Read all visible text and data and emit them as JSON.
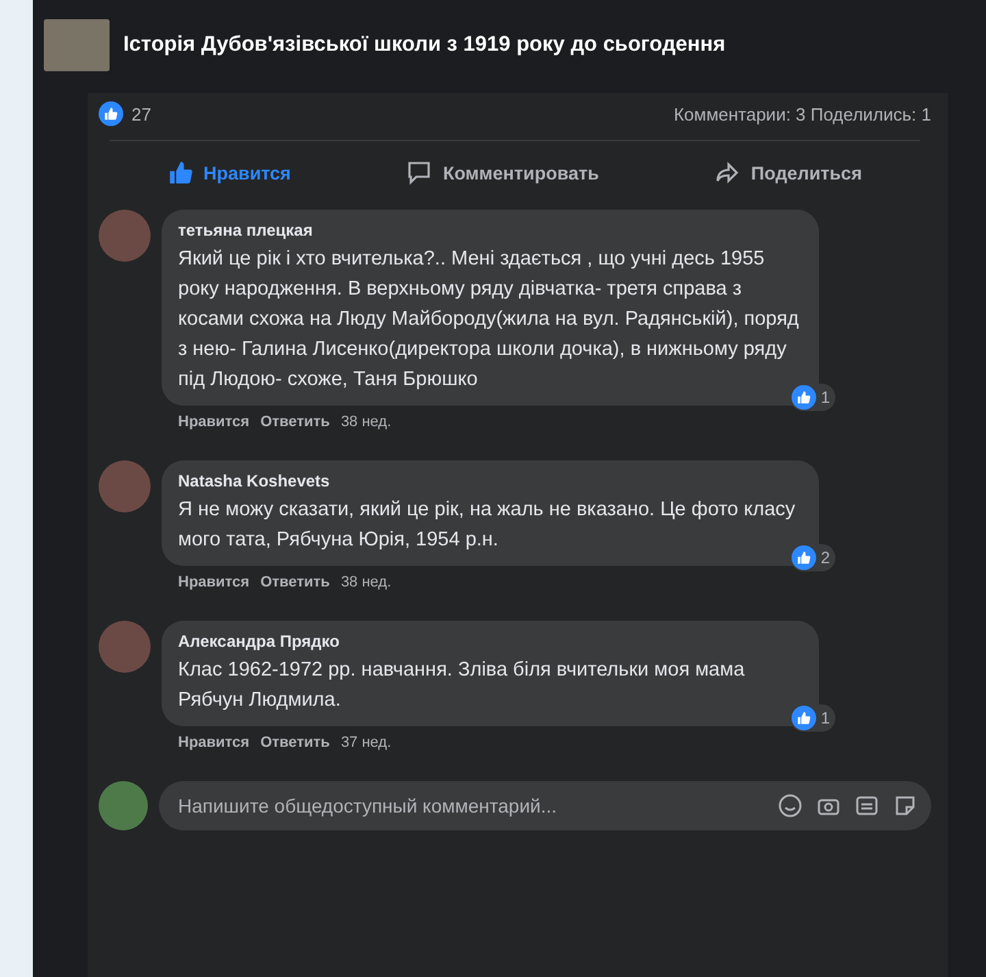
{
  "post": {
    "title": "Історія Дубов'язівської школи з 1919 року до сьогодення"
  },
  "stats": {
    "reactions": "27",
    "comments_shares": "Комментарии: 3  Поделились: 1"
  },
  "actions": [
    {
      "kind": "like",
      "label": "Нравится",
      "selected": true
    },
    {
      "kind": "comment",
      "label": "Комментировать",
      "selected": false
    },
    {
      "kind": "share",
      "label": "Поделиться",
      "selected": false
    }
  ],
  "comments": [
    {
      "author": "тетьяна плецкая",
      "text": "Який це рік і хто вчителька?.. Мені здається , що учні десь 1955 року народження. В верхньому ряду дівчатка- третя справа з косами схожа на Люду Майбороду(жила на вул. Радянській), поряд з нею- Галина Лисенко(директора школи дочка), в нижньому ряду під Людою- схоже, Таня Брюшко",
      "like": "Нравится",
      "reply": "Ответить",
      "time": "38 нед.",
      "reactions": "1"
    },
    {
      "author": "Natasha Koshevets",
      "text": "Я не можу сказати, який це рік, на жаль не вказано. Це фото класу мого тата, Рябчуна Юрія, 1954 р.н.",
      "like": "Нравится",
      "reply": "Ответить",
      "time": "38 нед.",
      "reactions": "2"
    },
    {
      "author": "Александра Прядко",
      "text": "Клас 1962-1972 рр. навчання. Зліва біля вчительки моя мама Рябчун Людмила.",
      "like": "Нравится",
      "reply": "Ответить",
      "time": "37 нед.",
      "reactions": "1"
    }
  ],
  "composer": {
    "placeholder": "Напишите общедоступный комментарий..."
  }
}
